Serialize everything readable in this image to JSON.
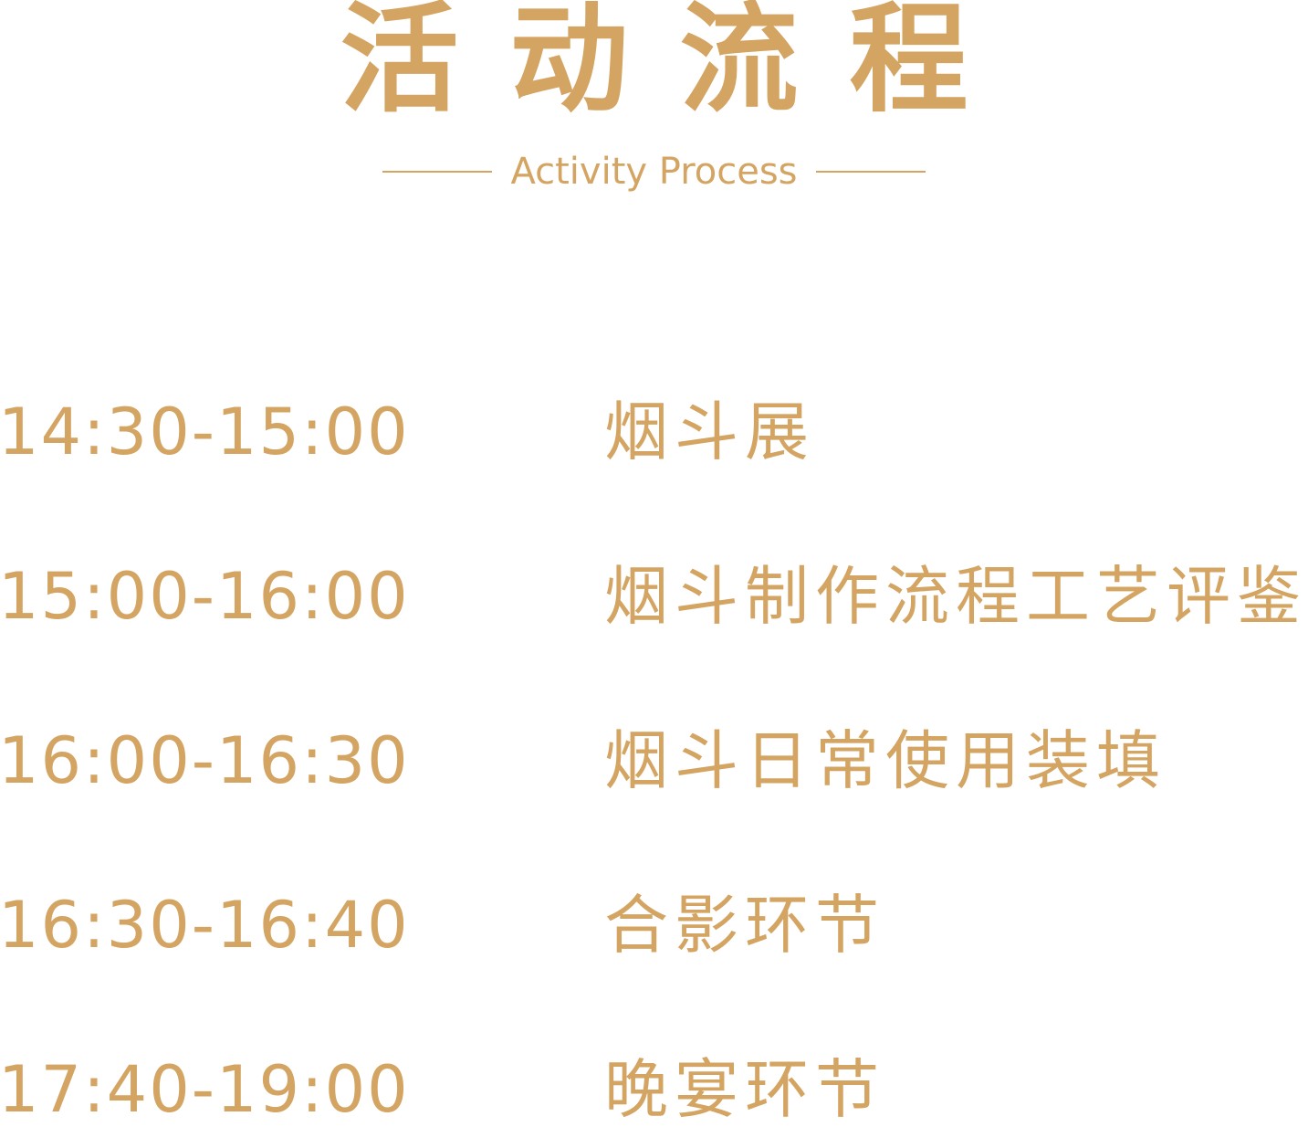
{
  "header": {
    "title": "活动流程",
    "subtitle": "Activity Process"
  },
  "schedule": [
    {
      "time": "14:30-15:00",
      "event": "烟斗展"
    },
    {
      "time": "15:00-16:00",
      "event": "烟斗制作流程工艺评鉴"
    },
    {
      "time": "16:00-16:30",
      "event": "烟斗日常使用装填"
    },
    {
      "time": "16:30-16:40",
      "event": "合影环节"
    },
    {
      "time": "17:40-19:00",
      "event": "晚宴环节"
    }
  ],
  "colors": {
    "accent": "#d4a462",
    "background": "#ffffff"
  }
}
